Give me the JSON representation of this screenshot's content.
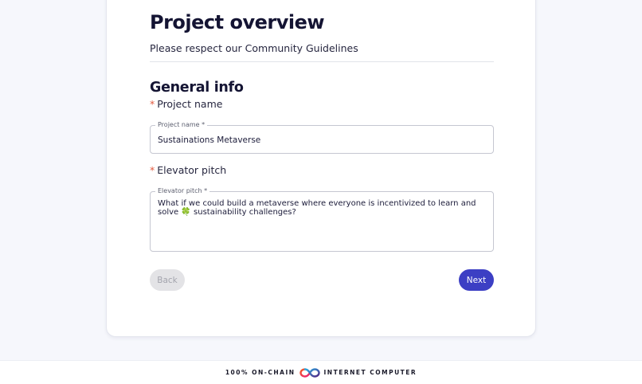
{
  "page": {
    "title": "Project overview",
    "subtitle": "Please respect our Community Guidelines"
  },
  "section": {
    "title": "General info"
  },
  "project_name": {
    "label": "Project name",
    "required_mark": "*",
    "legend": "Project name *",
    "value": "Sustainations Metaverse"
  },
  "elevator_pitch": {
    "label": "Elevator pitch",
    "required_mark": "*",
    "legend": "Elevator pitch *",
    "value": "What if we could build a metaverse where everyone is incentivized to learn and solve",
    "value_emoji": "🍀",
    "value_cont": "sustainability challenges?"
  },
  "buttons": {
    "back": "Back",
    "next": "Next"
  },
  "footer": {
    "left_text": "100% ON-CHAIN",
    "right_text": "INTERNET COMPUTER",
    "logo_icon": "infinity-logo-icon"
  },
  "colors": {
    "primary": "#3c3fc4",
    "required": "#e25a3f",
    "background": "#f6f7fc"
  }
}
